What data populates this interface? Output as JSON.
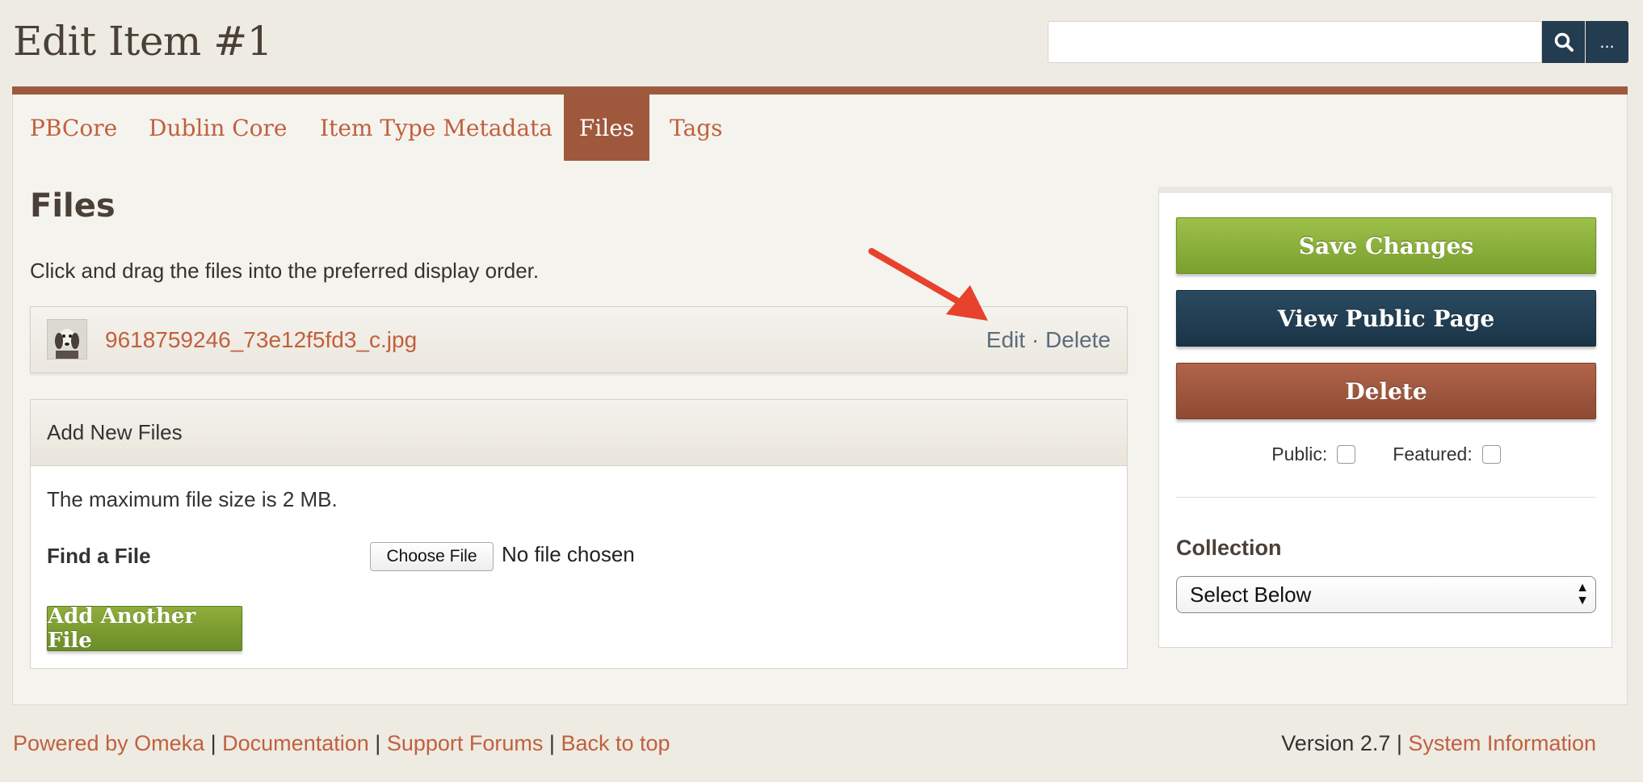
{
  "header": {
    "title": "Edit Item #1",
    "search_value": "",
    "search_options_label": "..."
  },
  "tabs": [
    {
      "label": "PBCore",
      "active": false
    },
    {
      "label": "Dublin Core",
      "active": false
    },
    {
      "label": "Item Type Metadata",
      "active": false
    },
    {
      "label": "Files",
      "active": true
    },
    {
      "label": "Tags",
      "active": false
    }
  ],
  "files_section": {
    "heading": "Files",
    "hint": "Click and drag the files into the preferred display order.",
    "file": {
      "name": "9618759246_73e12f5fd3_c.jpg",
      "edit_label": "Edit",
      "separator": "·",
      "delete_label": "Delete"
    }
  },
  "add_files": {
    "header": "Add New Files",
    "max_size_text": "The maximum file size is 2 MB.",
    "find_file_label": "Find a File",
    "choose_file_label": "Choose File",
    "no_file_text": "No file chosen",
    "add_another_label": "Add Another File"
  },
  "sidebar": {
    "save_label": "Save Changes",
    "view_public_label": "View Public Page",
    "delete_label": "Delete",
    "public_label": "Public:",
    "featured_label": "Featured:",
    "public_checked": false,
    "featured_checked": false,
    "collection_label": "Collection",
    "collection_selected": "Select Below"
  },
  "footer": {
    "powered_by": "Powered by Omeka",
    "documentation": "Documentation",
    "support_forums": "Support Forums",
    "back_to_top": "Back to top",
    "separator": "|",
    "version_text": "Version 2.7",
    "system_information": "System Information"
  },
  "colors": {
    "accent": "#c1603d",
    "tab_active_bg": "#a0583d",
    "save_green": "#8bb13c",
    "navy": "#233c4f",
    "delete_brown": "#9e5a3f",
    "annotation_arrow": "#e8412c"
  }
}
